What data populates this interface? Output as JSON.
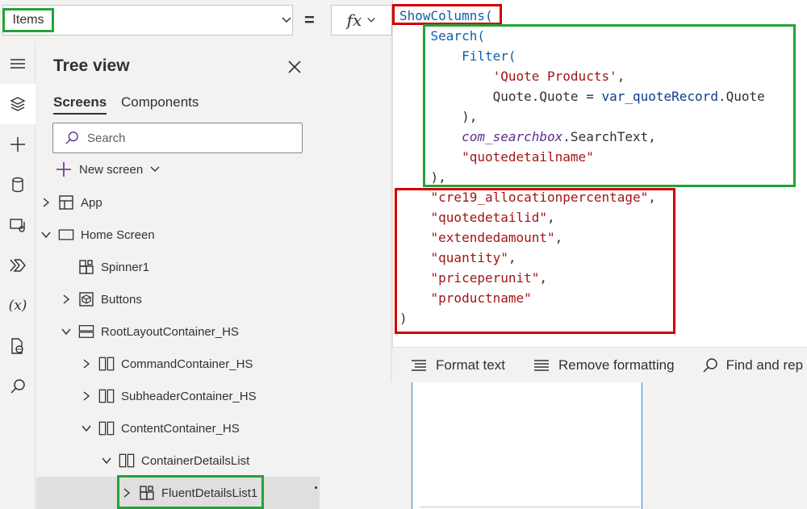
{
  "formula_bar": {
    "property": "Items",
    "equals": "=",
    "fx_label": "fx"
  },
  "code_lines": [
    [
      {
        "t": "ShowColumns(",
        "c": "fn"
      }
    ],
    [
      {
        "t": "    Search(",
        "c": "fn"
      }
    ],
    [
      {
        "t": "        Filter(",
        "c": "fn"
      }
    ],
    [
      {
        "t": "            'Quote Products'",
        "c": "str"
      },
      {
        "t": ",",
        "c": "plain"
      }
    ],
    [
      {
        "t": "            Quote.Quote = ",
        "c": "plain"
      },
      {
        "t": "var_quoteRecord",
        "c": "var"
      },
      {
        "t": ".Quote",
        "c": "plain"
      }
    ],
    [
      {
        "t": "        ),",
        "c": "plain"
      }
    ],
    [
      {
        "t": "        ",
        "c": "plain"
      },
      {
        "t": "com_searchbox",
        "c": "ctl"
      },
      {
        "t": ".SearchText,",
        "c": "plain"
      }
    ],
    [
      {
        "t": "        \"quotedetailname\"",
        "c": "str"
      }
    ],
    [
      {
        "t": "    ),",
        "c": "plain"
      }
    ],
    [
      {
        "t": "    \"cre19_allocationpercentage\"",
        "c": "str"
      },
      {
        "t": ",",
        "c": "plain"
      }
    ],
    [
      {
        "t": "    \"quotedetailid\"",
        "c": "str"
      },
      {
        "t": ",",
        "c": "plain"
      }
    ],
    [
      {
        "t": "    \"extendedamount\"",
        "c": "str"
      },
      {
        "t": ",",
        "c": "plain"
      }
    ],
    [
      {
        "t": "    \"quantity\"",
        "c": "str"
      },
      {
        "t": ",",
        "c": "plain"
      }
    ],
    [
      {
        "t": "    \"priceperunit\"",
        "c": "str"
      },
      {
        "t": ",",
        "c": "plain"
      }
    ],
    [
      {
        "t": "    \"productname\"",
        "c": "str"
      }
    ],
    [
      {
        "t": ")",
        "c": "plain"
      }
    ]
  ],
  "editor_toolbar": {
    "format_text": "Format text",
    "remove_formatting": "Remove formatting",
    "find_replace": "Find and rep"
  },
  "tree_view": {
    "title": "Tree view",
    "tabs": [
      "Screens",
      "Components"
    ],
    "search_placeholder": "Search",
    "new_screen": "New screen",
    "items": [
      {
        "label": "App",
        "indent": 0,
        "caret": "right",
        "icon": "app-icon"
      },
      {
        "label": "Home Screen",
        "indent": 0,
        "caret": "down",
        "icon": "screen-icon"
      },
      {
        "label": "Spinner1",
        "indent": 1,
        "caret": "none",
        "icon": "component-icon"
      },
      {
        "label": "Buttons",
        "indent": 1,
        "caret": "right",
        "icon": "group-icon"
      },
      {
        "label": "RootLayoutContainer_HS",
        "indent": 1,
        "caret": "down",
        "icon": "vertical-container-icon"
      },
      {
        "label": "CommandContainer_HS",
        "indent": 2,
        "caret": "right",
        "icon": "horizontal-container-icon"
      },
      {
        "label": "SubheaderContainer_HS",
        "indent": 2,
        "caret": "right",
        "icon": "horizontal-container-icon"
      },
      {
        "label": "ContentContainer_HS",
        "indent": 2,
        "caret": "down",
        "icon": "horizontal-container-icon"
      },
      {
        "label": "ContainerDetailsList",
        "indent": 3,
        "caret": "down",
        "icon": "horizontal-container-icon"
      },
      {
        "label": "FluentDetailsList1",
        "indent": 4,
        "caret": "right",
        "icon": "component-icon",
        "selected": true
      }
    ]
  },
  "rail_icons": [
    "hamburger-icon",
    "layers-icon",
    "plus-icon",
    "database-icon",
    "media-icon",
    "power-automate-icon",
    "variables-icon",
    "advanced-tools-icon",
    "search-icon"
  ],
  "colors": {
    "annotation_red": "#d00000",
    "annotation_green": "#22a33a",
    "function_blue": "#0e5fa6",
    "string_red": "#a31515"
  }
}
